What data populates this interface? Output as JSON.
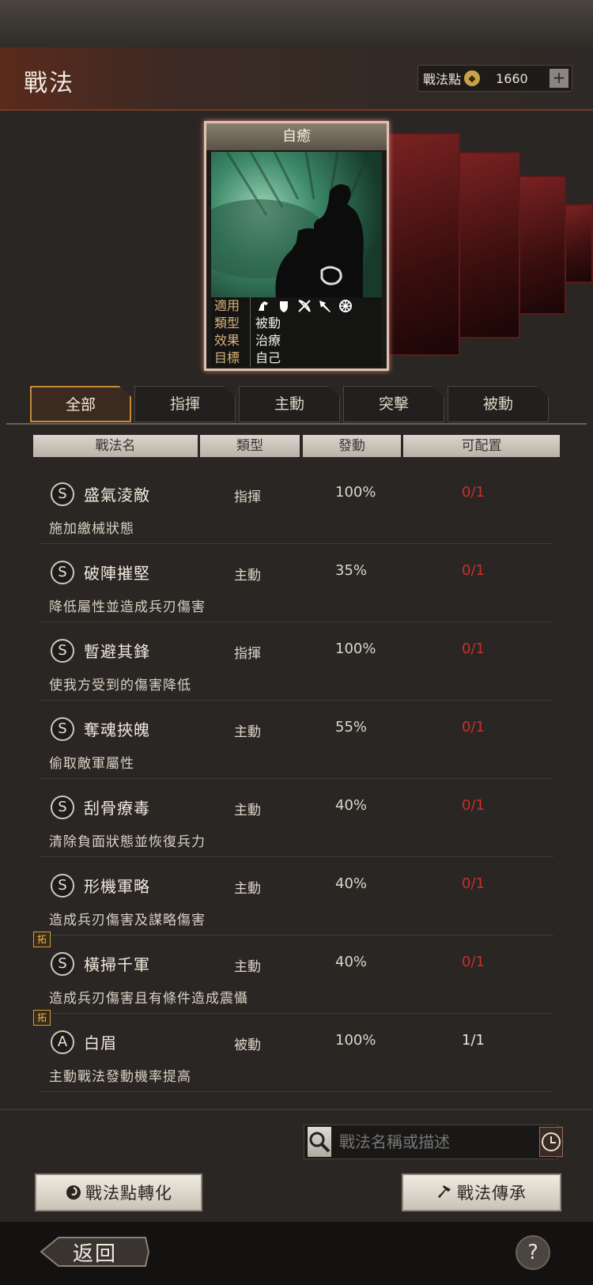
{
  "header": {
    "title": "戰法",
    "points_label": "戰法點",
    "points_value": "1660",
    "plus": "+"
  },
  "card": {
    "title": "自癒",
    "applicable_key": "適用",
    "type_key": "類型",
    "type_value": "被動",
    "effect_key": "效果",
    "effect_value": "治療",
    "target_key": "目標",
    "target_value": "自己",
    "unit_icons": [
      "cavalry-icon",
      "shield-icon",
      "bow-icon",
      "spear-icon",
      "wheel-icon"
    ]
  },
  "tabs": [
    {
      "label": "全部",
      "active": true
    },
    {
      "label": "指揮"
    },
    {
      "label": "主動"
    },
    {
      "label": "突擊"
    },
    {
      "label": "被動"
    }
  ],
  "columns": [
    "戰法名",
    "類型",
    "發動",
    "可配置"
  ],
  "skills": [
    {
      "grade": "S",
      "name": "盛氣淩敵",
      "type": "指揮",
      "rate": "100%",
      "slots": "0/1",
      "desc": "施加繳械狀態",
      "tag": ""
    },
    {
      "grade": "S",
      "name": "破陣摧堅",
      "type": "主動",
      "rate": "35%",
      "slots": "0/1",
      "desc": "降低屬性並造成兵刃傷害",
      "tag": ""
    },
    {
      "grade": "S",
      "name": "暫避其鋒",
      "type": "指揮",
      "rate": "100%",
      "slots": "0/1",
      "desc": "使我方受到的傷害降低",
      "tag": ""
    },
    {
      "grade": "S",
      "name": "奪魂挾魄",
      "type": "主動",
      "rate": "55%",
      "slots": "0/1",
      "desc": "偷取敵軍屬性",
      "tag": ""
    },
    {
      "grade": "S",
      "name": "刮骨療毒",
      "type": "主動",
      "rate": "40%",
      "slots": "0/1",
      "desc": "清除負面狀態並恢復兵力",
      "tag": ""
    },
    {
      "grade": "S",
      "name": "形機軍略",
      "type": "主動",
      "rate": "40%",
      "slots": "0/1",
      "desc": "造成兵刃傷害及謀略傷害",
      "tag": ""
    },
    {
      "grade": "S",
      "name": "橫掃千軍",
      "type": "主動",
      "rate": "40%",
      "slots": "0/1",
      "desc": "造成兵刃傷害且有條件造成震懾",
      "tag": "拓"
    },
    {
      "grade": "A",
      "name": "白眉",
      "type": "被動",
      "rate": "100%",
      "slots": "1/1",
      "desc": "主動戰法發動機率提高",
      "tag": "拓"
    }
  ],
  "search": {
    "placeholder": "戰法名稱或描述"
  },
  "buttons": {
    "convert": "戰法點轉化",
    "inherit": "戰法傳承",
    "back": "返回",
    "help": "?"
  },
  "colors": {
    "slot_full": "#c8302a",
    "accent": "#c58a3a"
  }
}
